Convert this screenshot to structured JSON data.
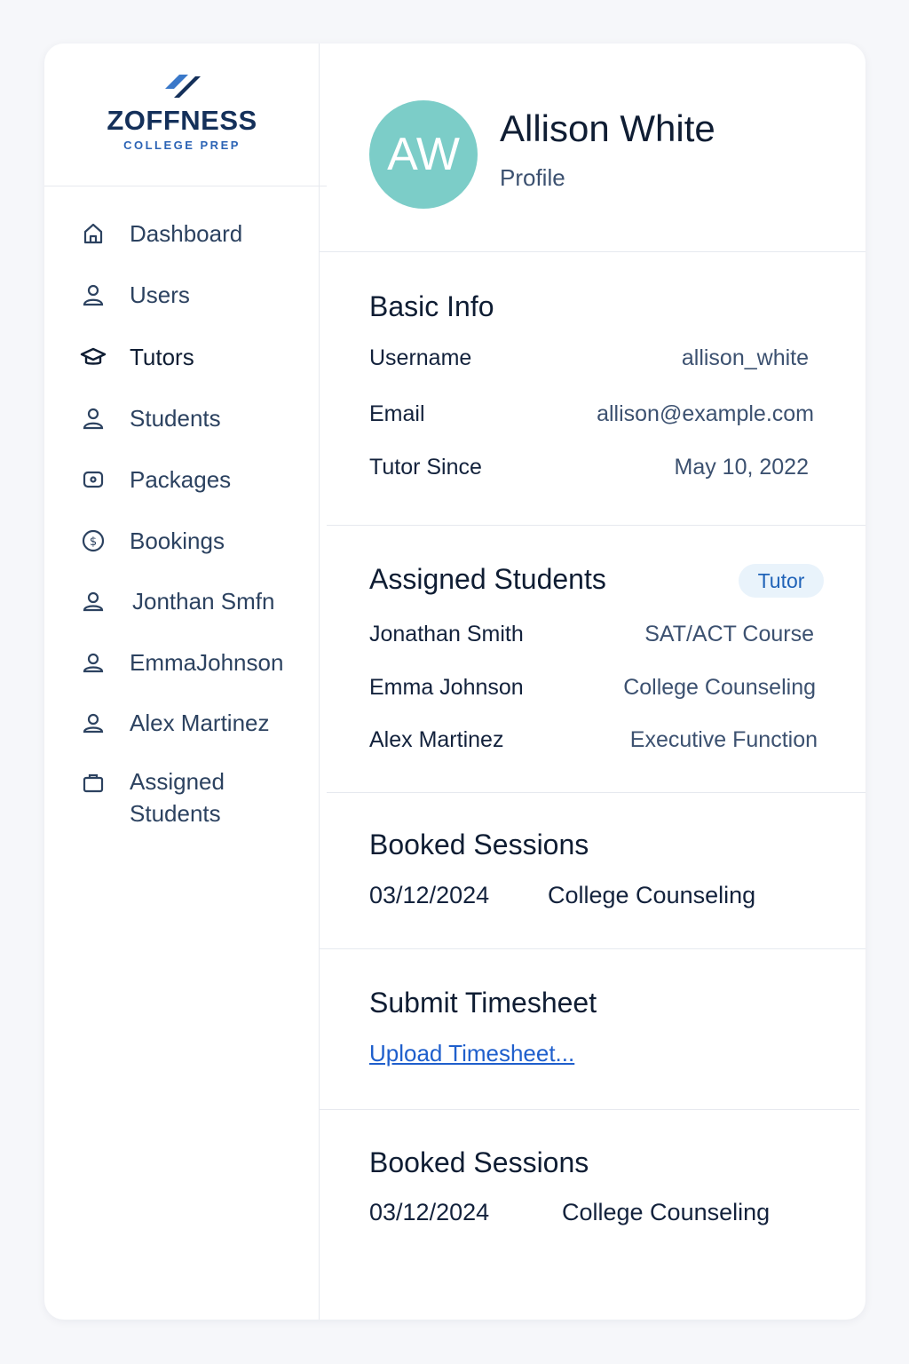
{
  "brand": {
    "name": "ZOFFNESS",
    "tagline": "COLLEGE PREP"
  },
  "sidebar": {
    "items": [
      {
        "label": "Dashboard",
        "icon": "home-icon"
      },
      {
        "label": "Users",
        "icon": "user-icon"
      },
      {
        "label": "Tutors",
        "icon": "graduation-cap-icon",
        "active": true
      },
      {
        "label": "Students",
        "icon": "user-icon"
      },
      {
        "label": "Packages",
        "icon": "package-icon"
      },
      {
        "label": "Bookings",
        "icon": "dollar-circle-icon"
      },
      {
        "label": "Jonthan Smfn",
        "icon": "user-icon"
      },
      {
        "label": "EmmaJohnson",
        "icon": "user-icon"
      },
      {
        "label": "Alex Martinez",
        "icon": "user-icon"
      },
      {
        "label": "Assigned Students",
        "icon": "briefcase-icon"
      }
    ]
  },
  "profile": {
    "initials": "AW",
    "name": "Allison White",
    "subtitle": "Profile",
    "avatar_color": "#7ccdc8"
  },
  "basic_info": {
    "title": "Basic Info",
    "rows": [
      {
        "label": "Username",
        "value": "allison_white"
      },
      {
        "label": "Email",
        "value": "allison@example.com"
      },
      {
        "label": "Tutor Since",
        "value": "May 10, 2022"
      }
    ]
  },
  "assigned_students": {
    "title": "Assigned Students",
    "badge": "Tutor",
    "rows": [
      {
        "name": "Jonathan Smith",
        "course": "SAT/ACT Course"
      },
      {
        "name": "Emma Johnson",
        "course": "College Counseling"
      },
      {
        "name": "Alex Martinez",
        "course": "Executive Function"
      }
    ]
  },
  "booked_sessions_1": {
    "title": "Booked Sessions",
    "date": "03/12/2024",
    "session": "College Counseling"
  },
  "timesheet": {
    "title": "Submit Timesheet",
    "link": "Upload Timesheet..."
  },
  "booked_sessions_2": {
    "title": "Booked Sessions",
    "date": "03/12/2024",
    "session": "College Counseling"
  },
  "colors": {
    "accent": "#2b63b5",
    "link": "#1f5fcc",
    "badge_bg": "#e9f3fb",
    "text": "#13223c"
  }
}
